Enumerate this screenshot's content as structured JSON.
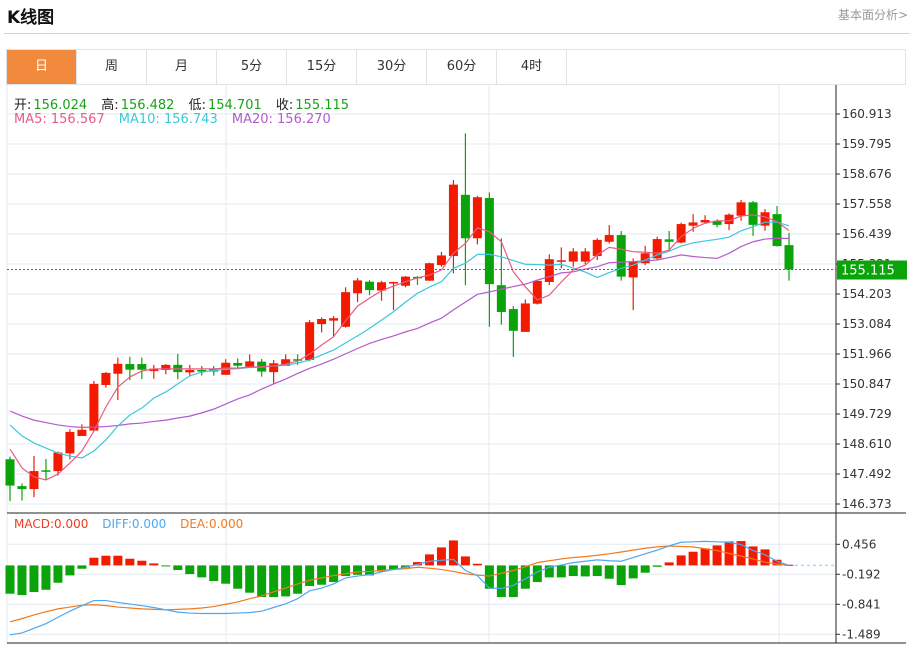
{
  "header": {
    "title": "K线图",
    "more_link": "基本面分析>"
  },
  "tabs": [
    {
      "label": "日",
      "active": true
    },
    {
      "label": "周"
    },
    {
      "label": "月"
    },
    {
      "label": "5分"
    },
    {
      "label": "15分"
    },
    {
      "label": "30分"
    },
    {
      "label": "60分"
    },
    {
      "label": "4时"
    }
  ],
  "ohlc_info": {
    "open_label": "开:",
    "open": "156.024",
    "high_label": "高:",
    "high": "156.482",
    "low_label": "低:",
    "low": "154.701",
    "close_label": "收:",
    "close": "155.115"
  },
  "ma_info": {
    "ma5": "MA5: 156.567",
    "ma10": "MA10: 156.743",
    "ma20": "MA20: 156.270"
  },
  "macd_info": {
    "macd": "MACD:0.000",
    "diff": "DIFF:0.000",
    "dea": "DEA:0.000"
  },
  "colors": {
    "up": "#f31a00",
    "down": "#0aa30a",
    "ma5": "#ea5a86",
    "ma10": "#3cc8dc",
    "ma20": "#b25ccc",
    "diff": "#4ea8f0",
    "dea": "#f27a1e",
    "active_tab": "#f28a3e",
    "last_price": "#0aa30a"
  },
  "chart_data": [
    {
      "type": "candlestick",
      "price_ticks": [
        "160.913",
        "159.795",
        "158.676",
        "157.558",
        "156.439",
        "155.321",
        "154.203",
        "153.084",
        "151.966",
        "150.847",
        "149.729",
        "148.610",
        "147.492",
        "146.373"
      ],
      "ylim": [
        146.373,
        160.913
      ],
      "last_price": "155.115",
      "candles_ohlc": [
        [
          148.04,
          148.14,
          146.48,
          147.06
        ],
        [
          147.04,
          147.14,
          146.5,
          146.93
        ],
        [
          146.93,
          148.16,
          146.63,
          147.6
        ],
        [
          147.63,
          148.05,
          147.27,
          147.59
        ],
        [
          147.6,
          148.33,
          147.43,
          148.29
        ],
        [
          148.26,
          149.16,
          148.04,
          149.06
        ],
        [
          148.91,
          149.34,
          148.91,
          149.14
        ],
        [
          149.11,
          150.96,
          149.07,
          150.85
        ],
        [
          150.81,
          151.29,
          150.71,
          151.26
        ],
        [
          151.23,
          151.83,
          150.25,
          151.6
        ],
        [
          151.59,
          151.86,
          150.99,
          151.38
        ],
        [
          151.59,
          151.83,
          151.03,
          151.38
        ],
        [
          151.33,
          151.56,
          151.04,
          151.42
        ],
        [
          151.37,
          151.59,
          151.21,
          151.56
        ],
        [
          151.56,
          151.97,
          151.02,
          151.29
        ],
        [
          151.28,
          151.56,
          151.15,
          151.37
        ],
        [
          151.37,
          151.52,
          151.16,
          151.31
        ],
        [
          151.39,
          151.52,
          151.16,
          151.31
        ],
        [
          151.19,
          151.77,
          151.19,
          151.64
        ],
        [
          151.63,
          151.8,
          151.44,
          151.53
        ],
        [
          151.49,
          151.95,
          151.49,
          151.69
        ],
        [
          151.68,
          151.78,
          151.12,
          151.31
        ],
        [
          151.29,
          151.74,
          150.84,
          151.62
        ],
        [
          151.52,
          151.95,
          151.52,
          151.77
        ],
        [
          151.77,
          151.95,
          151.56,
          151.72
        ],
        [
          151.74,
          153.23,
          151.7,
          153.15
        ],
        [
          153.08,
          153.33,
          152.77,
          153.27
        ],
        [
          153.21,
          153.38,
          152.61,
          153.3
        ],
        [
          152.98,
          154.45,
          152.95,
          154.27
        ],
        [
          154.23,
          154.8,
          153.9,
          154.71
        ],
        [
          154.66,
          154.72,
          154.16,
          154.35
        ],
        [
          154.33,
          154.69,
          153.95,
          154.64
        ],
        [
          154.6,
          154.66,
          153.6,
          154.65
        ],
        [
          154.51,
          154.87,
          154.45,
          154.85
        ],
        [
          154.84,
          154.87,
          154.54,
          154.82
        ],
        [
          154.7,
          155.37,
          154.69,
          155.35
        ],
        [
          155.28,
          155.77,
          155.22,
          155.64
        ],
        [
          155.62,
          158.45,
          154.97,
          158.28
        ],
        [
          157.9,
          160.19,
          154.53,
          156.28
        ],
        [
          156.28,
          157.86,
          156.05,
          157.81
        ],
        [
          157.78,
          157.99,
          152.98,
          154.57
        ],
        [
          154.53,
          156.28,
          153.06,
          153.53
        ],
        [
          153.64,
          153.75,
          151.86,
          152.83
        ],
        [
          152.79,
          154.0,
          152.79,
          153.85
        ],
        [
          153.84,
          154.69,
          153.81,
          154.69
        ],
        [
          154.65,
          155.68,
          154.53,
          155.5
        ],
        [
          155.41,
          155.94,
          155.16,
          155.46
        ],
        [
          155.41,
          155.91,
          155.22,
          155.79
        ],
        [
          155.41,
          155.91,
          155.32,
          155.79
        ],
        [
          155.62,
          156.28,
          155.47,
          156.22
        ],
        [
          156.15,
          156.77,
          156.09,
          156.4
        ],
        [
          156.4,
          156.55,
          154.7,
          154.85
        ],
        [
          154.82,
          155.53,
          153.6,
          155.41
        ],
        [
          155.35,
          156.0,
          155.28,
          155.72
        ],
        [
          155.53,
          156.34,
          155.47,
          156.25
        ],
        [
          156.24,
          156.55,
          155.84,
          156.15
        ],
        [
          156.12,
          156.86,
          156.09,
          156.81
        ],
        [
          156.75,
          157.18,
          156.52,
          156.87
        ],
        [
          156.87,
          157.14,
          156.83,
          156.96
        ],
        [
          156.93,
          156.99,
          156.69,
          156.78
        ],
        [
          156.81,
          157.21,
          156.58,
          157.16
        ],
        [
          157.12,
          157.71,
          156.93,
          157.62
        ],
        [
          157.62,
          157.67,
          156.37,
          156.78
        ],
        [
          156.75,
          157.37,
          156.56,
          157.25
        ],
        [
          157.18,
          157.48,
          155.97,
          155.99
        ],
        [
          156.024,
          156.482,
          154.701,
          155.115
        ]
      ],
      "ma5": [
        148.42,
        147.72,
        147.38,
        147.27,
        147.49,
        147.9,
        148.35,
        149.09,
        149.99,
        150.73,
        151.11,
        151.33,
        151.41,
        151.41,
        151.41,
        151.41,
        151.41,
        151.41,
        151.44,
        151.44,
        151.48,
        151.49,
        151.52,
        151.59,
        151.7,
        151.96,
        152.3,
        152.61,
        153.2,
        153.75,
        154.05,
        154.32,
        154.5,
        154.66,
        154.8,
        154.91,
        155.1,
        155.72,
        156.09,
        156.67,
        156.52,
        156.15,
        155.03,
        154.47,
        153.98,
        154.16,
        154.65,
        155.1,
        155.28,
        155.66,
        155.94,
        155.87,
        155.78,
        155.76,
        155.72,
        155.84,
        156.34,
        156.65,
        156.84,
        156.93,
        156.93,
        157.11,
        157.15,
        157.08,
        156.9,
        156.567
      ],
      "ma10": [
        149.32,
        148.91,
        148.65,
        148.46,
        148.27,
        148.16,
        148.09,
        148.35,
        148.76,
        149.28,
        149.69,
        149.95,
        150.32,
        150.55,
        150.85,
        151.15,
        151.29,
        151.35,
        151.39,
        151.42,
        151.46,
        151.48,
        151.52,
        151.54,
        151.63,
        151.74,
        151.93,
        152.11,
        152.38,
        152.64,
        152.92,
        153.23,
        153.54,
        153.9,
        154.23,
        154.46,
        154.66,
        155.16,
        155.35,
        155.68,
        155.68,
        155.59,
        155.45,
        155.31,
        155.3,
        155.28,
        155.31,
        155.17,
        155.02,
        154.82,
        155.0,
        155.16,
        155.28,
        155.47,
        155.66,
        155.8,
        155.99,
        156.11,
        156.18,
        156.24,
        156.32,
        156.56,
        156.71,
        156.88,
        156.88,
        156.743
      ],
      "ma20": [
        149.84,
        149.65,
        149.5,
        149.41,
        149.32,
        149.26,
        149.23,
        149.24,
        149.26,
        149.3,
        149.36,
        149.39,
        149.45,
        149.5,
        149.58,
        149.65,
        149.77,
        149.91,
        150.1,
        150.29,
        150.44,
        150.66,
        150.85,
        151.03,
        151.24,
        151.43,
        151.59,
        151.77,
        151.97,
        152.17,
        152.36,
        152.51,
        152.64,
        152.79,
        152.92,
        153.12,
        153.3,
        153.61,
        153.9,
        154.19,
        154.28,
        154.38,
        154.48,
        154.57,
        154.72,
        154.85,
        154.99,
        155.03,
        155.13,
        155.22,
        155.37,
        155.39,
        155.41,
        155.44,
        155.47,
        155.56,
        155.66,
        155.6,
        155.56,
        155.53,
        155.72,
        155.97,
        156.15,
        156.25,
        156.28,
        156.27
      ]
    },
    {
      "type": "macd",
      "ticks": [
        "0.456",
        "-0.192",
        "-0.841",
        "-1.489"
      ],
      "macd": [
        -0.612,
        -0.641,
        -0.576,
        -0.526,
        -0.374,
        -0.216,
        -0.072,
        0.166,
        0.209,
        0.209,
        0.144,
        0.101,
        0.043,
        -0.007,
        -0.101,
        -0.187,
        -0.259,
        -0.338,
        -0.396,
        -0.504,
        -0.59,
        -0.684,
        -0.684,
        -0.67,
        -0.612,
        -0.446,
        -0.418,
        -0.36,
        -0.23,
        -0.202,
        -0.216,
        -0.13,
        -0.086,
        -0.05,
        0.072,
        0.238,
        0.389,
        0.54,
        0.194,
        0.036,
        -0.504,
        -0.684,
        -0.684,
        -0.504,
        -0.36,
        -0.259,
        -0.259,
        -0.23,
        -0.238,
        -0.23,
        -0.288,
        -0.425,
        -0.281,
        -0.158,
        -0.029,
        0.065,
        0.216,
        0.295,
        0.367,
        0.432,
        0.518,
        0.526,
        0.41,
        0.346,
        0.122,
        0.014
      ],
      "diff": [
        -1.5,
        -1.46,
        -1.36,
        -1.26,
        -1.12,
        -0.99,
        -0.87,
        -0.76,
        -0.76,
        -0.8,
        -0.835,
        -0.87,
        -0.91,
        -0.96,
        -1.01,
        -1.03,
        -1.04,
        -1.04,
        -1.04,
        -1.03,
        -1.02,
        -0.99,
        -0.91,
        -0.83,
        -0.72,
        -0.55,
        -0.49,
        -0.4,
        -0.27,
        -0.23,
        -0.2,
        -0.14,
        -0.09,
        -0.04,
        0.02,
        0.09,
        0.11,
        0.13,
        -0.11,
        -0.22,
        -0.49,
        -0.5,
        -0.43,
        -0.29,
        -0.14,
        -0.04,
        0.01,
        0.06,
        0.09,
        0.12,
        0.1,
        0.09,
        0.17,
        0.25,
        0.33,
        0.42,
        0.5,
        0.51,
        0.52,
        0.51,
        0.5,
        0.45,
        0.32,
        0.23,
        0.09,
        0.0
      ],
      "dea": [
        -1.22,
        -1.15,
        -1.07,
        -1.0,
        -0.94,
        -0.9,
        -0.86,
        -0.85,
        -0.87,
        -0.9,
        -0.92,
        -0.94,
        -0.95,
        -0.96,
        -0.95,
        -0.94,
        -0.92,
        -0.89,
        -0.84,
        -0.79,
        -0.72,
        -0.66,
        -0.57,
        -0.49,
        -0.4,
        -0.32,
        -0.27,
        -0.22,
        -0.18,
        -0.14,
        -0.13,
        -0.11,
        -0.09,
        -0.07,
        -0.04,
        -0.06,
        -0.09,
        -0.13,
        -0.18,
        -0.21,
        -0.23,
        -0.17,
        -0.11,
        -0.03,
        0.06,
        0.1,
        0.14,
        0.17,
        0.19,
        0.22,
        0.25,
        0.29,
        0.33,
        0.37,
        0.4,
        0.42,
        0.41,
        0.4,
        0.36,
        0.32,
        0.26,
        0.2,
        0.14,
        0.07,
        0.03,
        0.0
      ]
    }
  ]
}
